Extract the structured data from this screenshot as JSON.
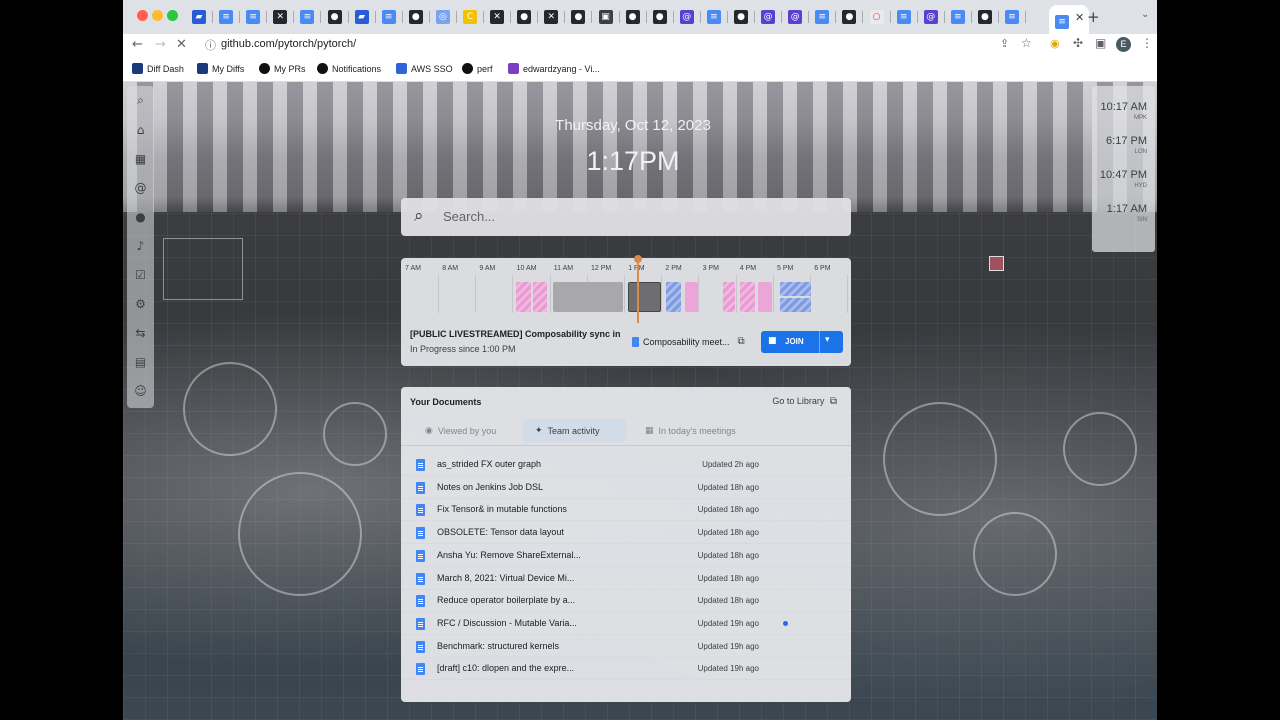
{
  "browser": {
    "url": "github.com/pytorch/pytorch/",
    "profile_initial": "E",
    "bookmarks": [
      {
        "label": "Diff Dash",
        "color": "#1a3a7a"
      },
      {
        "label": "My Diffs",
        "color": "#1a3a7a"
      },
      {
        "label": "My PRs",
        "color": "#111111"
      },
      {
        "label": "Notifications",
        "color": "#111111"
      },
      {
        "label": "AWS SSO",
        "color": "#2d64d8"
      },
      {
        "label": "perf",
        "color": "#111111"
      },
      {
        "label": "edwardzyang - Vi...",
        "color": "#7b3fc4"
      }
    ]
  },
  "page": {
    "date": "Thursday, Oct 12, 2023",
    "time": "1:17PM",
    "search_placeholder": "Search...",
    "clocks": [
      {
        "time": "10:17 AM",
        "city": "MPK"
      },
      {
        "time": "6:17 PM",
        "city": "LON"
      },
      {
        "time": "10:47 PM",
        "city": "HYD"
      },
      {
        "time": "1:17 AM",
        "city": "SIN"
      }
    ],
    "calendar": {
      "hours": [
        "7 AM",
        "8 AM",
        "9 AM",
        "10 AM",
        "11 AM",
        "12 PM",
        "1 PM",
        "2 PM",
        "3 PM",
        "4 PM",
        "5 PM",
        "6 PM"
      ],
      "meeting_title": "[PUBLIC LIVESTREAMED] Composability sync in",
      "meeting_status": "In Progress since 1:00 PM",
      "meeting_doc": "Composability meet...",
      "join_label": "JOIN"
    },
    "documents": {
      "title": "Your Documents",
      "library_label": "Go to Library",
      "tabs": [
        "Viewed by you",
        "Team activity",
        "In today's meetings"
      ],
      "active_tab": "Team activity",
      "rows": [
        {
          "title": "as_strided FX outer graph",
          "updated": "Updated 2h ago"
        },
        {
          "title": "Notes on Jenkins Job DSL",
          "updated": "Updated 18h ago"
        },
        {
          "title": "Fix Tensor& in mutable functions",
          "updated": "Updated 18h ago"
        },
        {
          "title": "OBSOLETE: Tensor data layout",
          "updated": "Updated 18h ago"
        },
        {
          "title": "Ansha Yu: Remove ShareExternal...",
          "updated": "Updated 18h ago"
        },
        {
          "title": "March 8, 2021: Virtual Device Mi...",
          "updated": "Updated 18h ago"
        },
        {
          "title": "Reduce operator boilerplate by a...",
          "updated": "Updated 18h ago"
        },
        {
          "title": "RFC / Discussion - Mutable Varia...",
          "updated": "Updated 19h ago"
        },
        {
          "title": "Benchmark: structured kernels",
          "updated": "Updated 19h ago"
        },
        {
          "title": "[draft] c10: dlopen and the expre...",
          "updated": "Updated 19h ago"
        }
      ]
    }
  }
}
